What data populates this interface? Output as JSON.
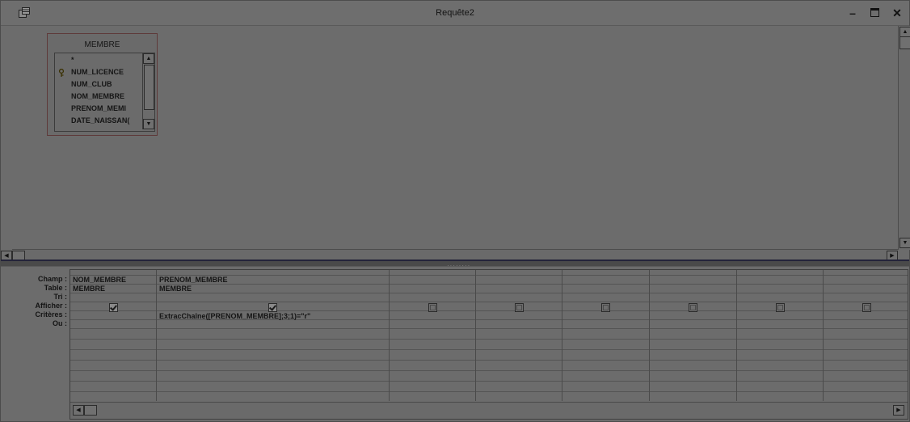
{
  "window": {
    "title": "Requête2",
    "icon": "query-design-icon",
    "controls": {
      "minimize": "–",
      "maximize": "□",
      "close": "✕"
    }
  },
  "table": {
    "name": "MEMBRE",
    "fields": [
      {
        "label": "*",
        "key": false
      },
      {
        "label": "NUM_LICENCE",
        "key": true
      },
      {
        "label": "NUM_CLUB",
        "key": false
      },
      {
        "label": "NOM_MEMBRE",
        "key": false
      },
      {
        "label": "PRENOM_MEMI",
        "key": false
      },
      {
        "label": "DATE_NAISSAN(",
        "key": false
      }
    ]
  },
  "grid": {
    "row_labels": [
      "Champ :",
      "Table :",
      "Tri :",
      "Afficher :",
      "Critères :",
      "Ou :"
    ],
    "columns": [
      {
        "champ": "NOM_MEMBRE",
        "table": "MEMBRE",
        "tri": "",
        "afficher": true,
        "criteres": "",
        "ou": ""
      },
      {
        "champ": "PRENOM_MEMBRE",
        "table": "MEMBRE",
        "tri": "",
        "afficher": true,
        "criteres": "ExtracChaîne([PRENOM_MEMBRE];3;1)=\"r\"",
        "ou": ""
      },
      {
        "champ": "",
        "table": "",
        "tri": "",
        "afficher": false,
        "criteres": "",
        "ou": ""
      },
      {
        "champ": "",
        "table": "",
        "tri": "",
        "afficher": false,
        "criteres": "",
        "ou": ""
      },
      {
        "champ": "",
        "table": "",
        "tri": "",
        "afficher": false,
        "criteres": "",
        "ou": ""
      },
      {
        "champ": "",
        "table": "",
        "tri": "",
        "afficher": false,
        "criteres": "",
        "ou": ""
      },
      {
        "champ": "",
        "table": "",
        "tri": "",
        "afficher": false,
        "criteres": "",
        "ou": ""
      },
      {
        "champ": "",
        "table": "",
        "tri": "",
        "afficher": false,
        "criteres": "",
        "ou": ""
      }
    ]
  }
}
